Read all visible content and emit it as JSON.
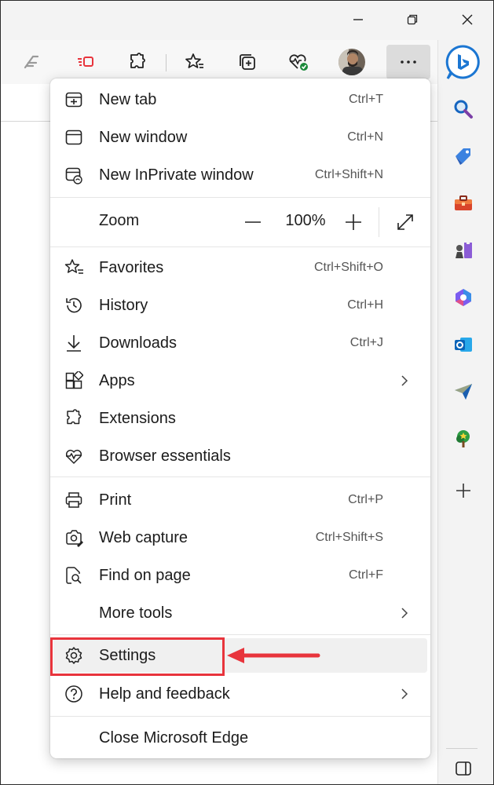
{
  "colors": {
    "accent": "#0f6cbd",
    "annotation": "#e8343c",
    "menu_bg": "#ffffff",
    "chrome_bg": "#f3f3f3"
  },
  "titlebar": {
    "icons": [
      "minimize-icon",
      "restore-icon",
      "close-icon"
    ]
  },
  "toolbar": {
    "icons": [
      "read-aloud-icon",
      "tab-actions-icon",
      "extensions-icon",
      "favorites-icon",
      "collections-icon",
      "browser-essentials-icon",
      "profile-avatar",
      "more-menu-icon"
    ],
    "menu_label": "···"
  },
  "sidebar": {
    "icons": [
      "bing-copilot-icon",
      "search-icon",
      "shopping-tag-icon",
      "tools-icon",
      "games-icon",
      "microsoft-365-icon",
      "outlook-icon",
      "drop-send-icon",
      "tree-icon",
      "add-icon",
      "sidebar-toggle-icon"
    ]
  },
  "menu": {
    "new_tab": {
      "label": "New tab",
      "shortcut": "Ctrl+T"
    },
    "new_window": {
      "label": "New window",
      "shortcut": "Ctrl+N"
    },
    "new_inprivate": {
      "label": "New InPrivate window",
      "shortcut": "Ctrl+Shift+N"
    },
    "zoom": {
      "label": "Zoom",
      "value": "100%",
      "minus": "—",
      "plus": "+"
    },
    "favorites": {
      "label": "Favorites",
      "shortcut": "Ctrl+Shift+O"
    },
    "history": {
      "label": "History",
      "shortcut": "Ctrl+H"
    },
    "downloads": {
      "label": "Downloads",
      "shortcut": "Ctrl+J"
    },
    "apps": {
      "label": "Apps"
    },
    "extensions": {
      "label": "Extensions"
    },
    "browser_essentials": {
      "label": "Browser essentials"
    },
    "print": {
      "label": "Print",
      "shortcut": "Ctrl+P"
    },
    "web_capture": {
      "label": "Web capture",
      "shortcut": "Ctrl+Shift+S"
    },
    "find_on_page": {
      "label": "Find on page",
      "shortcut": "Ctrl+F"
    },
    "more_tools": {
      "label": "More tools"
    },
    "settings": {
      "label": "Settings"
    },
    "help": {
      "label": "Help and feedback"
    },
    "close": {
      "label": "Close Microsoft Edge"
    }
  }
}
